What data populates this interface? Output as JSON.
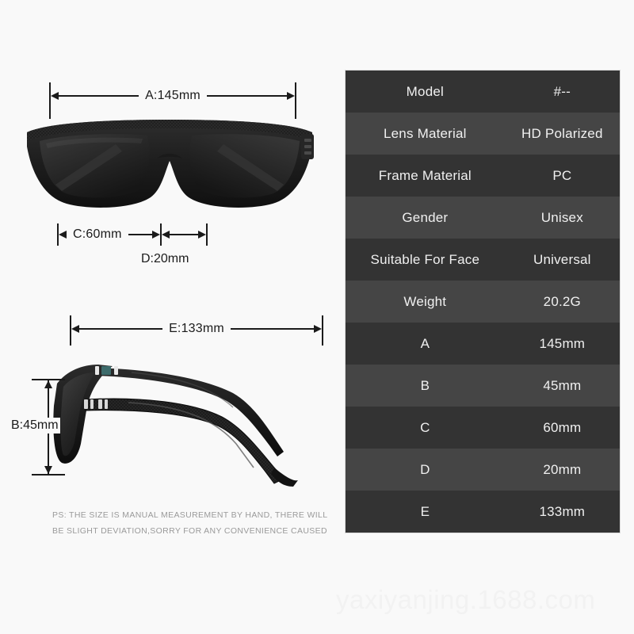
{
  "background_color": "#f9f9f9",
  "product": {
    "type": "sunglasses",
    "views": [
      "front-view",
      "side-view"
    ]
  },
  "dimensions": {
    "a": {
      "label": "A:145mm",
      "orientation": "horizontal",
      "view": "front-view"
    },
    "b": {
      "label": "B:45mm",
      "orientation": "vertical",
      "view": "side-view"
    },
    "c": {
      "label": "C:60mm",
      "orientation": "horizontal",
      "view": "front-view"
    },
    "d": {
      "label": "D:20mm",
      "orientation": "horizontal",
      "view": "front-view"
    },
    "e": {
      "label": "E:133mm",
      "orientation": "horizontal",
      "view": "side-view"
    }
  },
  "footnote": {
    "line1": "PS: THE SIZE IS MANUAL MEASUREMENT BY HAND, THERE WILL",
    "line2": "BE SLIGHT DEVIATION,SORRY FOR ANY CONVENIENCE CAUSED",
    "color": "#9a9a9a"
  },
  "spec_table": {
    "row_color_odd": "#333333",
    "row_color_even": "#454545",
    "text_color": "#f0f0f0",
    "rows": [
      {
        "key": "Model",
        "value": "#--"
      },
      {
        "key": "Lens Material",
        "value": "HD Polarized"
      },
      {
        "key": "Frame Material",
        "value": "PC"
      },
      {
        "key": "Gender",
        "value": "Unisex"
      },
      {
        "key": "Suitable For Face",
        "value": "Universal"
      },
      {
        "key": "Weight",
        "value": "20.2G"
      },
      {
        "key": "A",
        "value": "145mm"
      },
      {
        "key": "B",
        "value": "45mm"
      },
      {
        "key": "C",
        "value": "60mm"
      },
      {
        "key": "D",
        "value": "20mm"
      },
      {
        "key": "E",
        "value": "133mm"
      }
    ]
  },
  "watermark": {
    "text": "yaxiyanjing.1688.com",
    "color": "#f2f2f2"
  }
}
